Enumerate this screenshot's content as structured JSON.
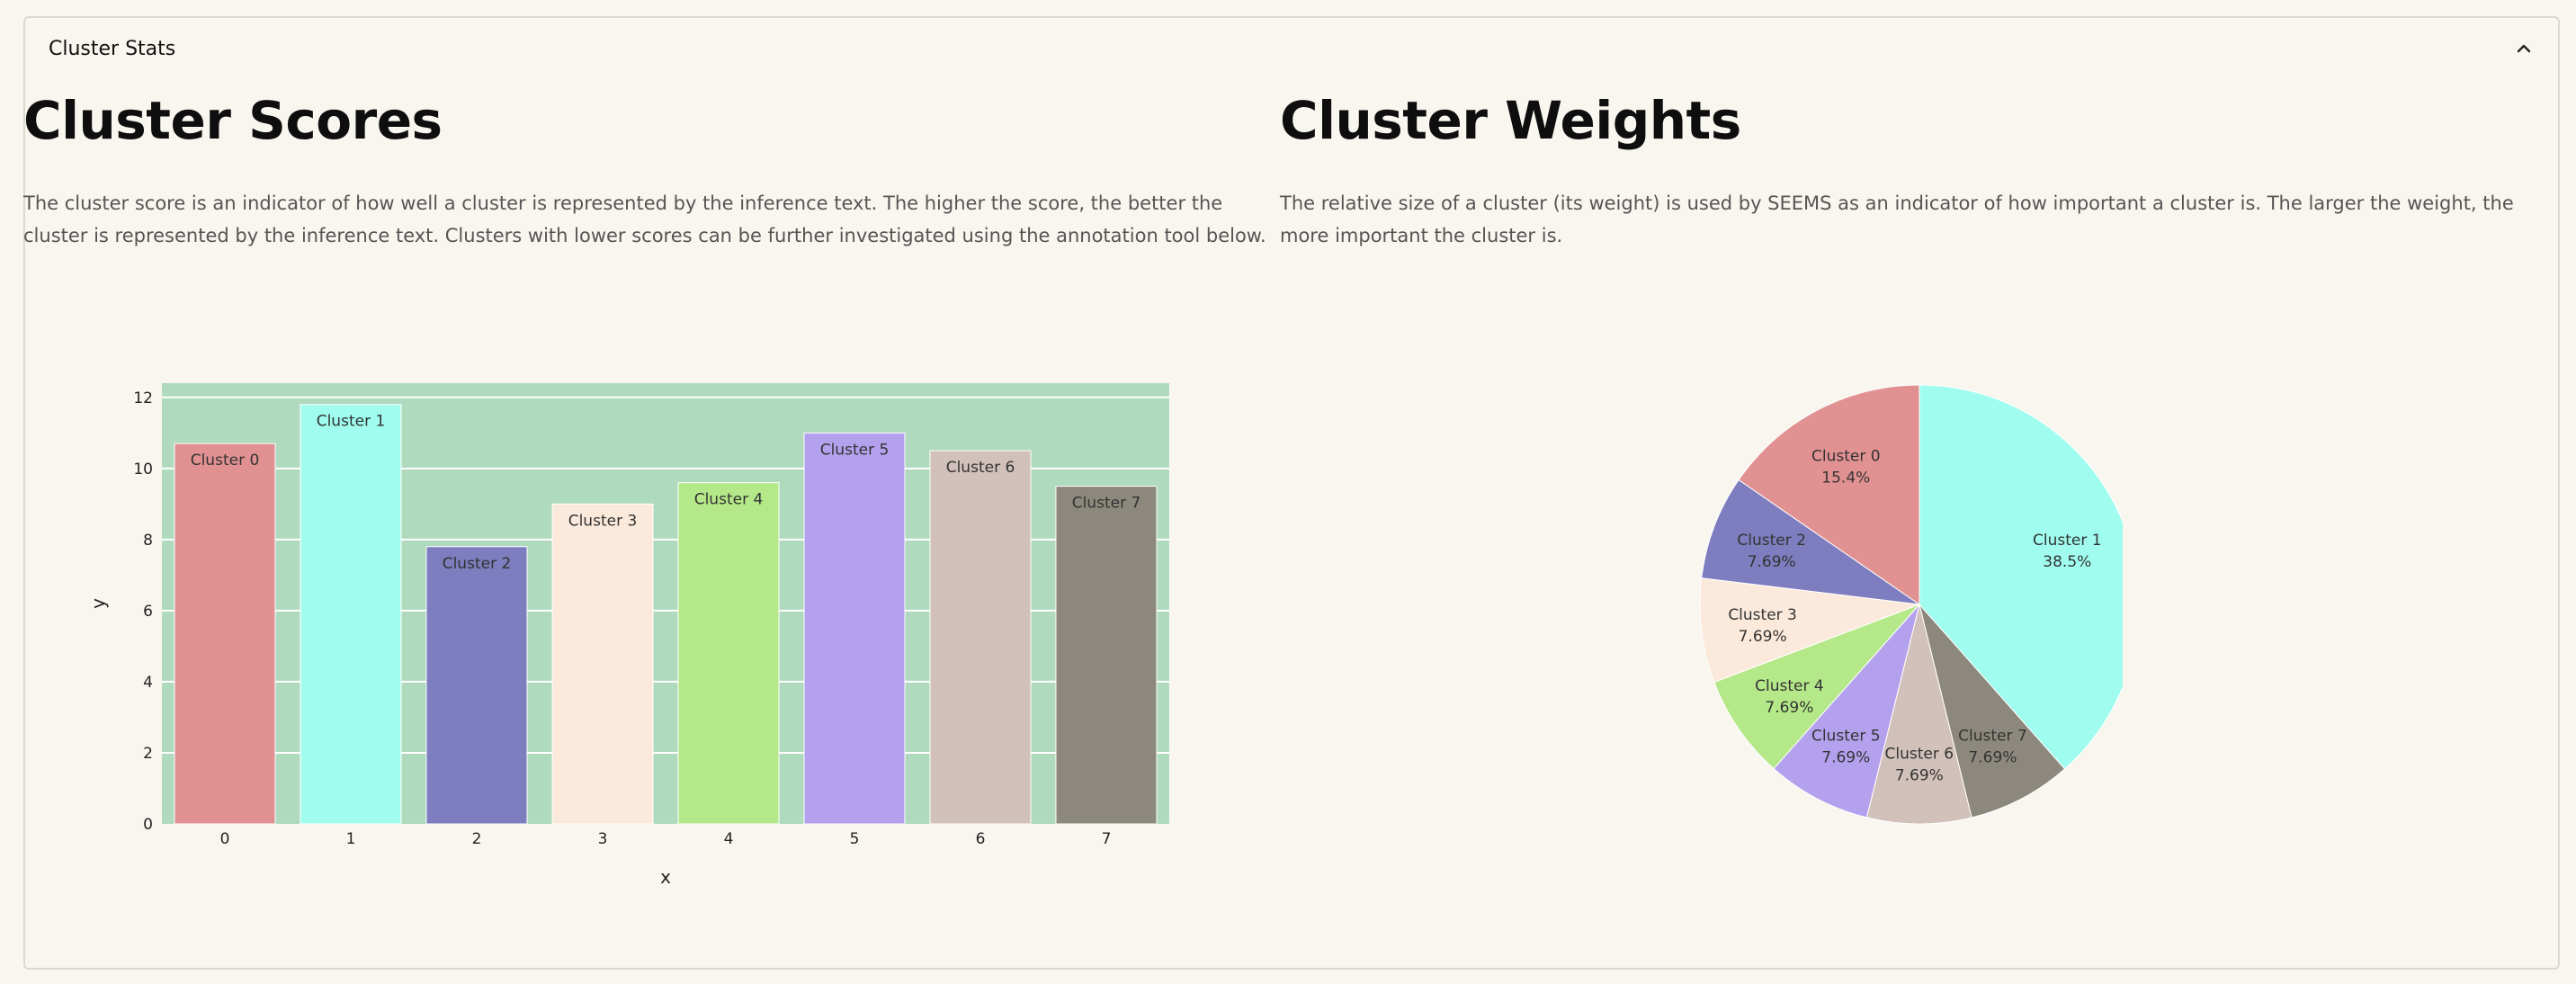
{
  "expander": {
    "title": "Cluster Stats"
  },
  "left": {
    "heading": "Cluster Scores",
    "description": "The cluster score is an indicator of how well a cluster is represented by the inference text. The higher the score, the better the cluster is represented by the inference text. Clusters with lower scores can be further investigated using the annotation tool below."
  },
  "right": {
    "heading": "Cluster Weights",
    "description": "The relative size of a cluster (its weight) is used by SEEMS as an indicator of how important a cluster is. The larger the weight, the more important the cluster is."
  },
  "colors": {
    "plot_bg": "#b0dabe",
    "cluster": [
      "#e29192",
      "#9ffcee",
      "#7d7dbf",
      "#fbeadb",
      "#b5e888",
      "#b4a1ed",
      "#d2c1bb",
      "#8d887d"
    ]
  },
  "chart_data": [
    {
      "type": "bar",
      "categories": [
        "0",
        "1",
        "2",
        "3",
        "4",
        "5",
        "6",
        "7"
      ],
      "bar_labels": [
        "Cluster 0",
        "Cluster 1",
        "Cluster 2",
        "Cluster 3",
        "Cluster 4",
        "Cluster 5",
        "Cluster 6",
        "Cluster 7"
      ],
      "values": [
        10.7,
        11.8,
        7.8,
        9.0,
        9.6,
        11.0,
        10.5,
        9.5
      ],
      "xlabel": "x",
      "ylabel": "y",
      "yticks": [
        0,
        2,
        4,
        6,
        8,
        10,
        12
      ],
      "ylim": [
        0,
        12.4
      ],
      "grid": true
    },
    {
      "type": "pie",
      "labels": [
        "Cluster 1",
        "Cluster 7",
        "Cluster 6",
        "Cluster 5",
        "Cluster 4",
        "Cluster 3",
        "Cluster 2",
        "Cluster 0"
      ],
      "values": [
        38.5,
        7.69,
        7.69,
        7.69,
        7.69,
        7.69,
        7.69,
        15.4
      ],
      "value_labels": [
        "38.5%",
        "7.69%",
        "7.69%",
        "7.69%",
        "7.69%",
        "7.69%",
        "7.69%",
        "15.4%"
      ],
      "direction": "clockwise",
      "start": "top"
    }
  ]
}
